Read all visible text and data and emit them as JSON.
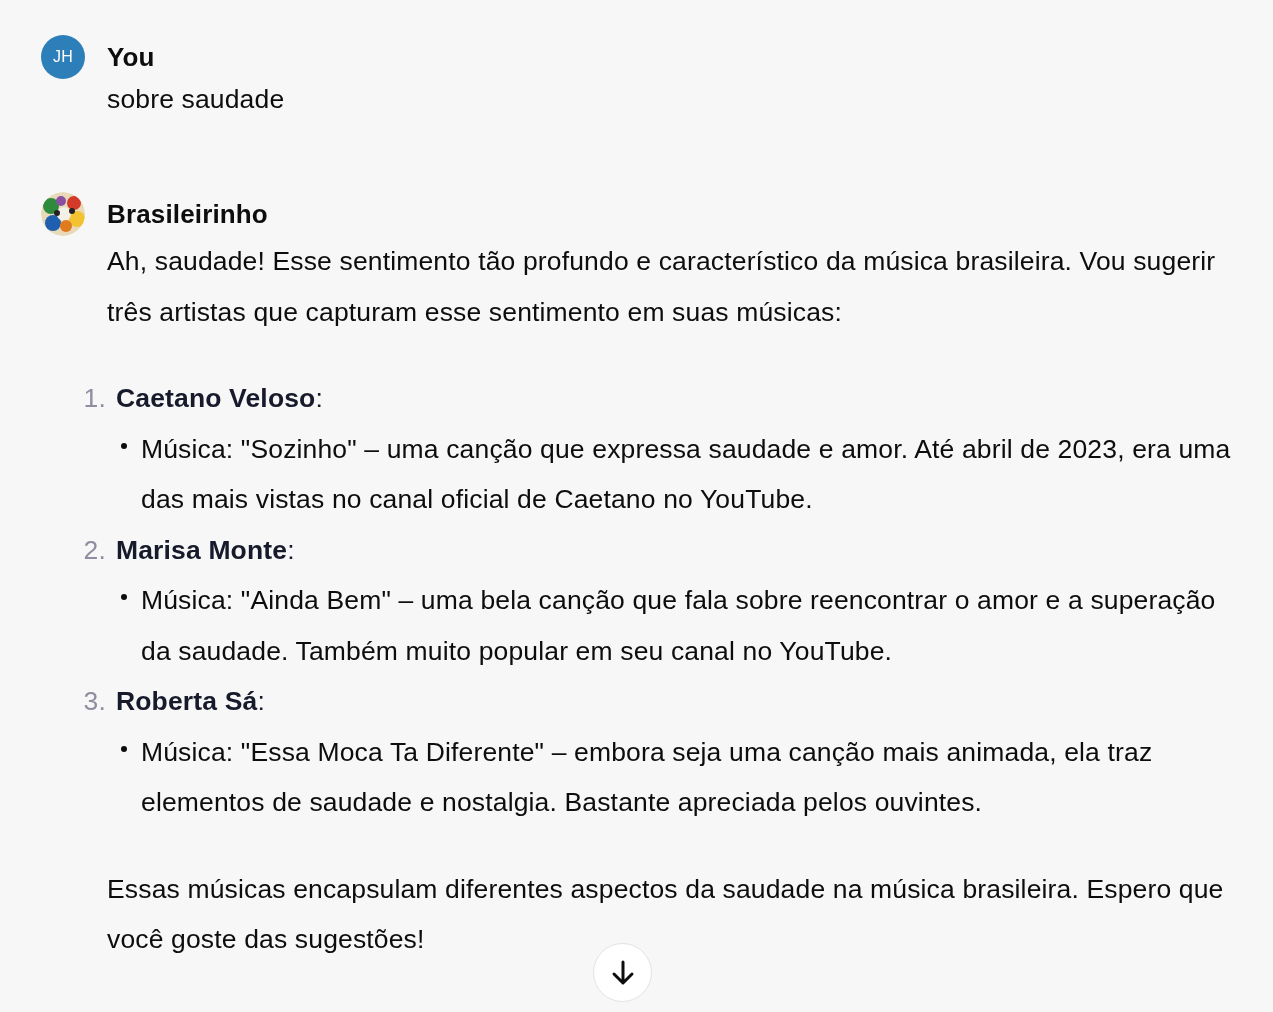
{
  "messages": [
    {
      "author": "You",
      "avatar": {
        "kind": "initials",
        "text": "JH",
        "color": "#2c7fb8"
      },
      "content": [
        {
          "kind": "paragraph",
          "text": "sobre saudade"
        }
      ]
    },
    {
      "author": "Brasileirinho",
      "content": [
        {
          "kind": "paragraph",
          "text": "Ah, saudade! Esse sentimento tão profundo e característico da música brasileira. Vou sugerir três artistas que capturam esse sentimento em suas músicas:"
        },
        {
          "kind": "ordered_list",
          "items": [
            {
              "number": "1.",
              "title": "**Caetano Veloso**:",
              "bullets": [
                "Música: \"Sozinho\" – uma canção que expressa saudade e amor. Até abril de 2023, era uma das mais vistas no canal oficial de Caetano no YouTube."
              ]
            },
            {
              "number": "2.",
              "title": "**Marisa Monte**:",
              "bullets": [
                "Música: \"Ainda Bem\" – uma bela canção que fala sobre reencontrar o amor e a superação da saudade. Também muito popular em seu canal no YouTube."
              ]
            },
            {
              "number": "3.",
              "title": "**Roberta Sá**:",
              "bullets": [
                "Música: \"Essa Moca Ta Diferente\" – embora seja uma canção mais animada, ela traz elementos de saudade e nostalgia. Bastante apreciada pelos ouvintes."
              ]
            }
          ]
        },
        {
          "kind": "paragraph",
          "text": "Essas músicas encapsulam diferentes aspectos da saudade na música brasileira. Espero que você goste das sugestões!"
        }
      ]
    }
  ]
}
